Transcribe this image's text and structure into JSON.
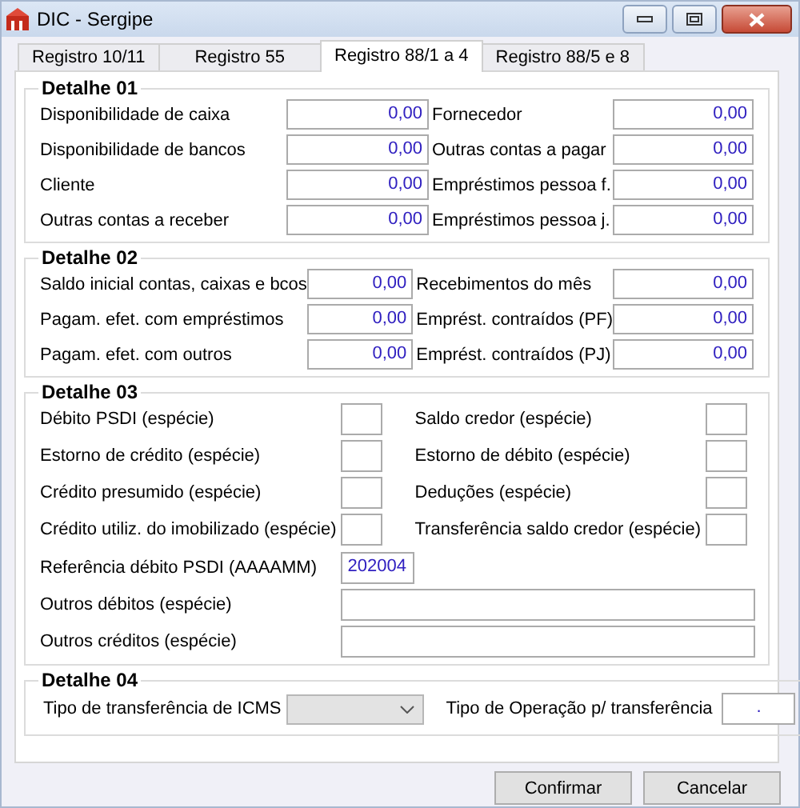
{
  "window": {
    "title": "DIC - Sergipe"
  },
  "tabs": [
    {
      "label": "Registro 10/11",
      "selected": false
    },
    {
      "label": "Registro 55",
      "selected": false
    },
    {
      "label": "Registro 88/1 a 4",
      "selected": true
    },
    {
      "label": "Registro 88/5 e 8",
      "selected": false
    }
  ],
  "groups": [
    {
      "title": "Detalhe 01",
      "kind": "pairs",
      "fields": [
        {
          "kind": "money",
          "label": "Disponibilidade de caixa",
          "value": "0,00"
        },
        {
          "kind": "money",
          "label": "Fornecedor",
          "value": "0,00"
        },
        {
          "kind": "money",
          "label": "Disponibilidade de bancos",
          "value": "0,00"
        },
        {
          "kind": "money",
          "label": "Outras contas a pagar",
          "value": "0,00"
        },
        {
          "kind": "money",
          "label": "Cliente",
          "value": "0,00"
        },
        {
          "kind": "money",
          "label": "Empréstimos pessoa f.",
          "value": "0,00"
        },
        {
          "kind": "money",
          "label": "Outras contas a receber",
          "value": "0,00"
        },
        {
          "kind": "money",
          "label": "Empréstimos pessoa j.",
          "value": "0,00"
        }
      ]
    },
    {
      "title": "Detalhe 02",
      "kind": "pairs",
      "fields": [
        {
          "kind": "money",
          "label": "Saldo inicial contas, caixas e bcos",
          "value": "0,00"
        },
        {
          "kind": "money",
          "label": "Recebimentos do mês",
          "value": "0,00"
        },
        {
          "kind": "money",
          "label": "Pagam. efet. com empréstimos",
          "value": "0,00"
        },
        {
          "kind": "money",
          "label": "Emprést. contraídos (PF)",
          "value": "0,00"
        },
        {
          "kind": "money",
          "label": "Pagam. efet. com outros",
          "value": "0,00"
        },
        {
          "kind": "money",
          "label": "Emprést. contraídos (PJ)",
          "value": "0,00"
        }
      ]
    },
    {
      "title": "Detalhe 03",
      "kind": "species",
      "fields": [
        {
          "kind": "small",
          "label": "Débito PSDI (espécie)"
        },
        {
          "kind": "small",
          "label": "Saldo credor (espécie)"
        },
        {
          "kind": "small",
          "label": "Estorno de crédito (espécie)"
        },
        {
          "kind": "small",
          "label": "Estorno de débito (espécie)"
        },
        {
          "kind": "small",
          "label": "Crédito presumido (espécie)"
        },
        {
          "kind": "small",
          "label": "Deduções (espécie)"
        },
        {
          "kind": "small",
          "label": "Crédito utiliz. do imobilizado (espécie)"
        },
        {
          "kind": "small",
          "label": "Transferência saldo credor (espécie)"
        },
        {
          "kind": "code",
          "label": "Referência débito PSDI (AAAAMM)",
          "value": "202004"
        },
        {
          "kind": "wide",
          "label": "Outros débitos (espécie)"
        },
        {
          "kind": "wide",
          "label": "Outros créditos (espécie)"
        }
      ]
    },
    {
      "title": "Detalhe 04",
      "kind": "inline",
      "fields": [
        {
          "kind": "combo",
          "label": "Tipo de transferência de ICMS",
          "disabled": true
        },
        {
          "kind": "text",
          "label": "Tipo de Operação p/ transferência",
          "value": "."
        }
      ]
    }
  ],
  "buttons": [
    "Confirmar",
    "Cancelar"
  ]
}
